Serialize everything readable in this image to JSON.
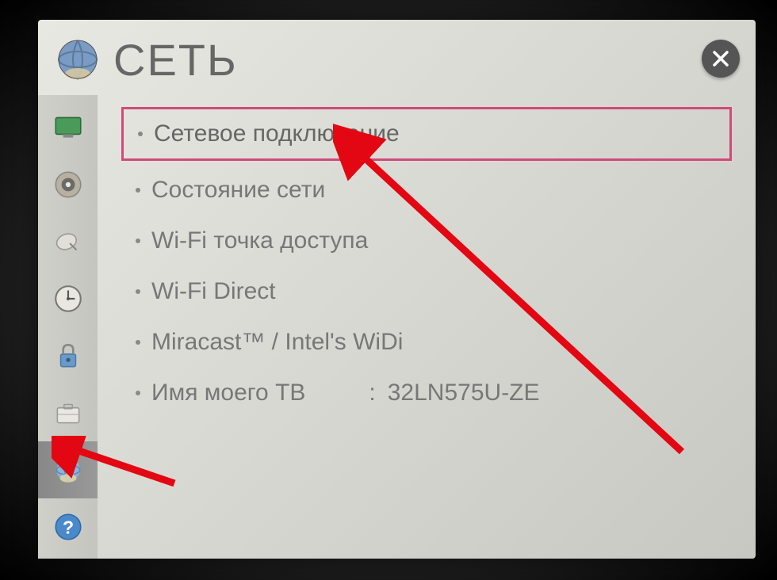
{
  "header": {
    "title": "СЕТЬ"
  },
  "sidebar": {
    "items": [
      {
        "name": "picture",
        "active": false
      },
      {
        "name": "sound",
        "active": false
      },
      {
        "name": "channel",
        "active": false
      },
      {
        "name": "time",
        "active": false
      },
      {
        "name": "lock",
        "active": false
      },
      {
        "name": "option",
        "active": false
      },
      {
        "name": "network",
        "active": true
      },
      {
        "name": "support",
        "active": false
      }
    ]
  },
  "menu": {
    "items": [
      {
        "label": "Сетевое подключение",
        "highlighted": true
      },
      {
        "label": "Состояние сети",
        "highlighted": false
      },
      {
        "label": "Wi-Fi точка доступа",
        "highlighted": false
      },
      {
        "label": "Wi-Fi Direct",
        "highlighted": false
      },
      {
        "label": "Miracast™ / Intel's WiDi",
        "highlighted": false
      },
      {
        "label": "Имя моего ТВ",
        "separator": ":",
        "value": "32LN575U-ZE",
        "highlighted": false
      }
    ]
  },
  "annotations": {
    "arrow_color": "#e30613"
  }
}
